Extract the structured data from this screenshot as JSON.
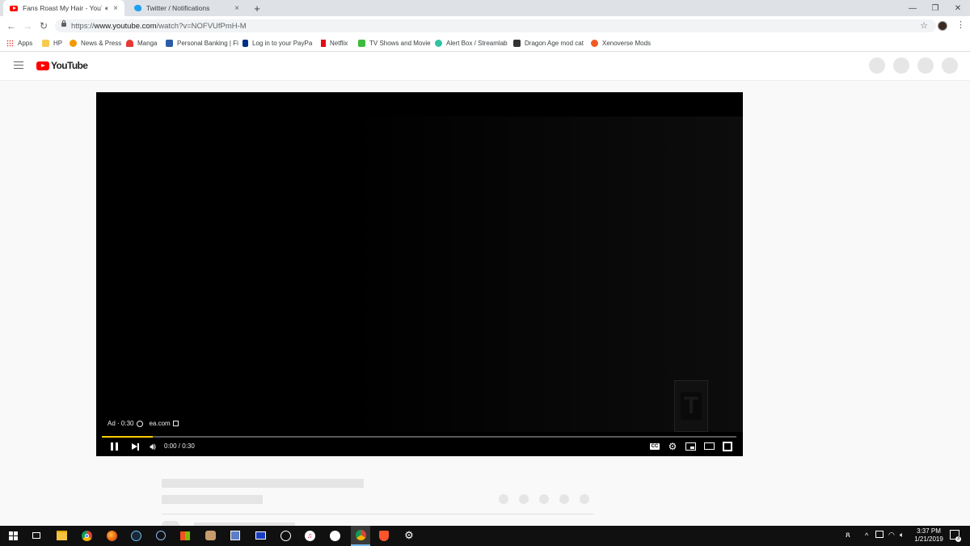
{
  "tabs": [
    {
      "title": "Fans Roast My Hair - YouTub",
      "icon": "youtube-icon",
      "audio_icon": "speaker-icon",
      "close": "×",
      "active": true
    },
    {
      "title": "Twitter / Notifications",
      "icon": "twitter-icon",
      "close": "×",
      "active": false
    }
  ],
  "new_tab": "+",
  "window_controls": {
    "minimize": "—",
    "restore": "❐",
    "close": "✕"
  },
  "nav": {
    "back": "←",
    "forward": "→",
    "reload": "↻"
  },
  "omnibox": {
    "scheme": "https://",
    "host": "www.youtube.com",
    "path": "/watch?v=NOFVUfPmH-M",
    "lock": "lock-icon",
    "star": "☆"
  },
  "bookmarks": [
    {
      "label": "Apps",
      "icon": "apps-grid-icon",
      "color": "#e8453c"
    },
    {
      "label": "HP",
      "icon": "folder-icon",
      "color": "#f7cb4d"
    },
    {
      "label": "News & Press",
      "icon": "news-icon",
      "color": "#f29900"
    },
    {
      "label": "Manga",
      "icon": "manga-icon",
      "color": "#e53935"
    },
    {
      "label": "Personal Banking | Fi",
      "icon": "bank-icon",
      "color": "#2a5ca8"
    },
    {
      "label": "Log in to your PayPa",
      "icon": "paypal-icon",
      "color": "#003087"
    },
    {
      "label": "Netflix",
      "icon": "netflix-icon",
      "color": "#e50914"
    },
    {
      "label": "TV Shows and Movie",
      "icon": "hulu-icon",
      "color": "#3dbb3d"
    },
    {
      "label": "Alert Box / Streamlab",
      "icon": "streamlabs-icon",
      "color": "#31c3a2"
    },
    {
      "label": "Dragon Age mod cat",
      "icon": "nexus-icon",
      "color": "#333333"
    },
    {
      "label": "Xenoverse Mods",
      "icon": "xenoverse-icon",
      "color": "#f05a22"
    }
  ],
  "youtube": {
    "logo_text": "YouTube",
    "menu_icon": "hamburger-icon",
    "brand_color": "#ff0000"
  },
  "player": {
    "ad_label": "Ad · 0:30",
    "ad_info_icon": "info-icon",
    "ad_link": "ea.com",
    "time": "0:00 / 0:30",
    "progress": 0.08,
    "rating_badge": "T",
    "controls": {
      "pause": "pause-icon",
      "next": "next-icon",
      "volume": "volume-icon",
      "cc": "CC",
      "settings": "gear-icon",
      "miniplayer": "miniplayer-icon",
      "theater": "theater-icon",
      "fullscreen": "fullscreen-icon"
    }
  },
  "taskbar": {
    "time": "3:37 PM",
    "date": "1/21/2019",
    "notifications": "3",
    "apps": [
      "windows-start-icon",
      "task-view-icon",
      "file-explorer-icon",
      "chrome-icon",
      "firefox-icon",
      "steam-icon",
      "media-player-icon",
      "store-icon",
      "paint-icon",
      "photo-editor-icon",
      "monitor-icon",
      "obs-icon",
      "itunes-icon",
      "steam-icon",
      "chrome-active-icon",
      "brave-icon",
      "settings-gear-icon"
    ]
  }
}
